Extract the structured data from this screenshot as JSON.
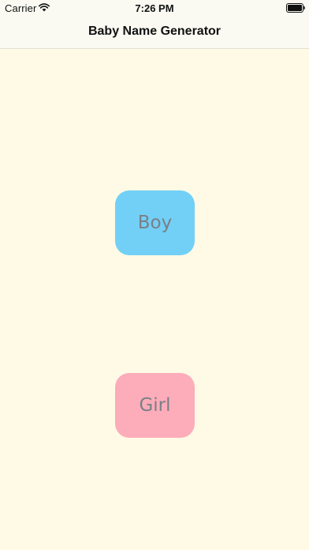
{
  "status_bar": {
    "carrier": "Carrier",
    "time": "7:26 PM",
    "wifi_icon": "wifi-icon",
    "battery_icon": "battery-icon"
  },
  "nav_bar": {
    "title": "Baby Name Generator"
  },
  "buttons": {
    "boy_label": "Boy",
    "girl_label": "Girl"
  },
  "colors": {
    "background": "#fefae6",
    "bar_background": "#fafaf3",
    "boy": "#72d0f6",
    "girl": "#fdacba",
    "button_text": "#7a7f87"
  }
}
